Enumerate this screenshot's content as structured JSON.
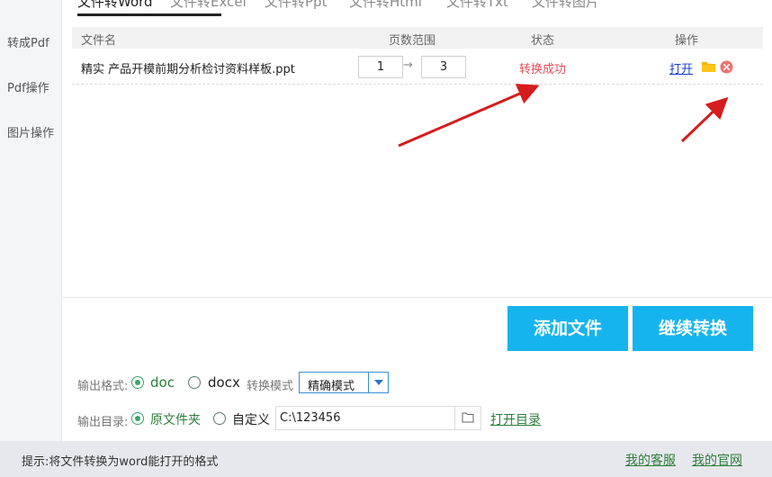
{
  "sidebar": {
    "items": [
      {
        "label": "转成Pdf"
      },
      {
        "label": "Pdf操作"
      },
      {
        "label": "图片操作"
      }
    ]
  },
  "tabs": [
    {
      "label": "文件转Word",
      "active": true
    },
    {
      "label": "文件转Excel"
    },
    {
      "label": "文件转Ppt"
    },
    {
      "label": "文件转Html"
    },
    {
      "label": "文件转Txt"
    },
    {
      "label": "文件转图片"
    }
  ],
  "table": {
    "headers": {
      "filename": "文件名",
      "pages": "页数范围",
      "status": "状态",
      "actions": "操作"
    },
    "rows": [
      {
        "filename": "精实  产品开模前期分析检讨资料样板.ppt",
        "page_from": "1",
        "page_to": "3",
        "status": "转换成功",
        "open": "打开"
      }
    ]
  },
  "buttons": {
    "add_file": "添加文件",
    "continue_convert": "继续转换"
  },
  "output_format": {
    "label": "输出格式:",
    "options": [
      "doc",
      "docx"
    ],
    "selected": "doc",
    "mode_label": "转换模式",
    "mode_value": "精确模式"
  },
  "output_dir": {
    "label": "输出目录:",
    "options": [
      "原文件夹",
      "自定义"
    ],
    "selected": "原文件夹",
    "path": "C:\\123456",
    "open_dir": "打开目录"
  },
  "footer": {
    "tip": "提示:将文件转换为word能打开的格式",
    "service": "我的客服",
    "website": "我的官网"
  },
  "colors": {
    "accent_blue": "#16b4ee",
    "status_red": "#e64b57",
    "link_green": "#2f7d3b",
    "annotation_red": "#d61c1c"
  }
}
